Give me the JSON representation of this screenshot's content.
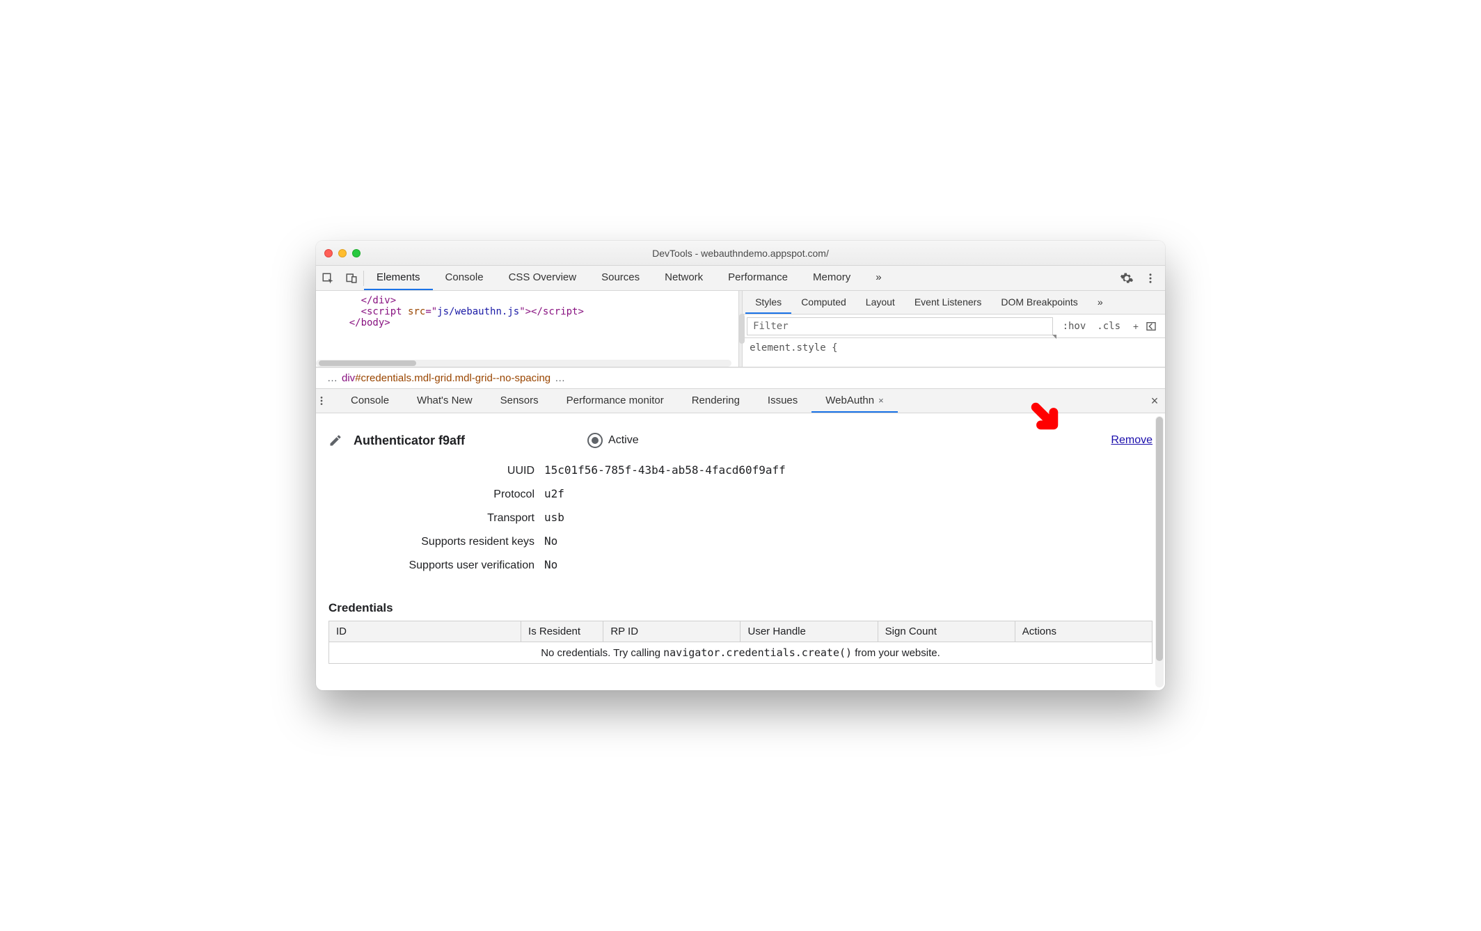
{
  "window": {
    "title": "DevTools - webauthndemo.appspot.com/"
  },
  "main_tabs": {
    "items": [
      "Elements",
      "Console",
      "CSS Overview",
      "Sources",
      "Network",
      "Performance",
      "Memory"
    ],
    "overflow": "»",
    "active_index": 0
  },
  "dom_snippet": {
    "lines": [
      {
        "indent": "      ",
        "tokens": [
          {
            "k": "tag",
            "t": "</div>"
          }
        ]
      },
      {
        "indent": "      ",
        "tokens": [
          {
            "k": "tag",
            "t": "<script "
          },
          {
            "k": "attr",
            "t": "src"
          },
          {
            "k": "tag",
            "t": "=\""
          },
          {
            "k": "value",
            "t": "js/webauthn.js"
          },
          {
            "k": "tag",
            "t": "\"></scr"
          },
          {
            "k": "tag",
            "t": "ipt>"
          }
        ]
      },
      {
        "indent": "    ",
        "tokens": [
          {
            "k": "tag",
            "t": "</body>"
          }
        ]
      }
    ]
  },
  "breadcrumb": {
    "left_dots": "…",
    "text_html": "div#credentials.mdl-grid.mdl-grid--no-spacing",
    "right_dots": "…"
  },
  "styles_tabs": {
    "items": [
      "Styles",
      "Computed",
      "Layout",
      "Event Listeners",
      "DOM Breakpoints"
    ],
    "overflow": "»",
    "active_index": 0
  },
  "styles_filter": {
    "placeholder": "Filter",
    "hov": ":hov",
    "cls": ".cls"
  },
  "styles_rule": "element.style {",
  "drawer_tabs": {
    "items": [
      "Console",
      "What's New",
      "Sensors",
      "Performance monitor",
      "Rendering",
      "Issues",
      "WebAuthn"
    ],
    "active_index": 6
  },
  "webauthn": {
    "authenticator_title": "Authenticator f9aff",
    "active_label": "Active",
    "remove_label": "Remove",
    "props": [
      {
        "label": "UUID",
        "value": "15c01f56-785f-43b4-ab58-4facd60f9aff"
      },
      {
        "label": "Protocol",
        "value": "u2f"
      },
      {
        "label": "Transport",
        "value": "usb"
      },
      {
        "label": "Supports resident keys",
        "value": "No"
      },
      {
        "label": "Supports user verification",
        "value": "No"
      }
    ],
    "credentials_heading": "Credentials",
    "table": {
      "headers": [
        "ID",
        "Is Resident",
        "RP ID",
        "User Handle",
        "Sign Count",
        "Actions"
      ],
      "empty_prefix": "No credentials. Try calling ",
      "empty_code": "navigator.credentials.create()",
      "empty_suffix": " from your website."
    }
  },
  "icons": {
    "gear": "gear-icon",
    "more": "more-vert-icon",
    "inspect": "inspect-icon",
    "devices": "devices-icon",
    "plus": "+",
    "layout": "layout-icon",
    "edit": "pencil-icon",
    "close_small": "×",
    "close": "×",
    "chevrons": "»"
  }
}
